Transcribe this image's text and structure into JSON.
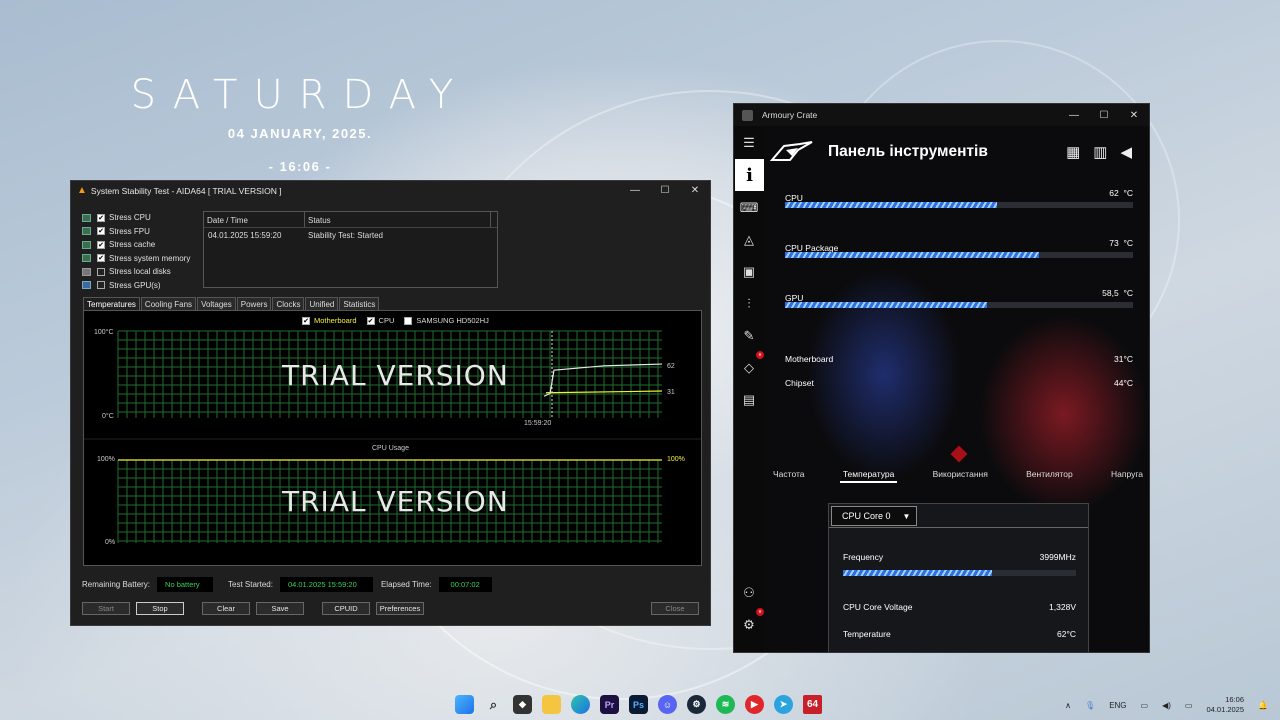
{
  "clock_widget": {
    "day": "SATURDAY",
    "date": "04 JANUARY, 2025.",
    "time": "- 16:06 -"
  },
  "aida": {
    "title": "System Stability Test - AIDA64  [ TRIAL VERSION ]",
    "window_controls": [
      "—",
      "☐",
      "✕"
    ],
    "stress_options": [
      {
        "label": "Stress CPU",
        "checked": true
      },
      {
        "label": "Stress FPU",
        "checked": true
      },
      {
        "label": "Stress cache",
        "checked": true
      },
      {
        "label": "Stress system memory",
        "checked": true
      },
      {
        "label": "Stress local disks",
        "checked": false
      },
      {
        "label": "Stress GPU(s)",
        "checked": false
      }
    ],
    "log": {
      "headers": [
        "Date / Time",
        "Status"
      ],
      "rows": [
        [
          "04.01.2025 15:59:20",
          "Stability Test: Started"
        ]
      ]
    },
    "tabs": [
      "Temperatures",
      "Cooling Fans",
      "Voltages",
      "Powers",
      "Clocks",
      "Unified",
      "Statistics"
    ],
    "temp_graph": {
      "legend": [
        "Motherboard",
        "CPU",
        "SAMSUNG HD502HJ"
      ],
      "y_top": "100°C",
      "y_bottom": "0°C",
      "x_label": "15:59:20",
      "watermark": "TRIAL VERSION",
      "value_cpu": "62",
      "value_mb": "31",
      "series_color_cpu": "#e8e8e8",
      "series_color_mb": "#f4f13a"
    },
    "usage_graph": {
      "title": "CPU Usage",
      "y_top": "100%",
      "y_bottom": "0%",
      "watermark": "TRIAL VERSION",
      "value": "100%",
      "series_color": "#f4f13a"
    },
    "status": {
      "battery_label": "Remaining Battery:",
      "battery_value": "No battery",
      "started_label": "Test Started:",
      "started_value": "04.01.2025 15:59:20",
      "elapsed_label": "Elapsed Time:",
      "elapsed_value": "00:07:02"
    },
    "buttons": {
      "start": "Start",
      "stop": "Stop",
      "clear": "Clear",
      "save": "Save",
      "cpuid": "CPUID",
      "preferences": "Preferences",
      "close": "Close"
    }
  },
  "armoury": {
    "title": "Armoury Crate",
    "window_controls": [
      "—",
      "☐",
      "✕"
    ],
    "header": "Панель інструментів",
    "bars": [
      {
        "label": "CPU",
        "value": "62",
        "unit": "°C",
        "fill_pct": 61
      },
      {
        "label": "CPU Package",
        "value": "73",
        "unit": "°C",
        "fill_pct": 73
      },
      {
        "label": "GPU",
        "value": "58,5",
        "unit": "°C",
        "fill_pct": 58
      }
    ],
    "readings": [
      {
        "label": "Motherboard",
        "value": "31°C"
      },
      {
        "label": "Chipset",
        "value": "44°C"
      }
    ],
    "tabs": [
      "Частота",
      "Температура",
      "Використання",
      "Вентилятор",
      "Напруга"
    ],
    "active_tab": "Температура",
    "panel": {
      "select": "CPU Core 0",
      "frequency_label": "Frequency",
      "frequency_value": "3999MHz",
      "frequency_fill_pct": 64,
      "voltage_label": "CPU Core Voltage",
      "voltage_value": "1,328V",
      "temp_label": "Temperature",
      "temp_value": "62°C"
    },
    "side_badges": [
      "н",
      "н"
    ]
  },
  "taskbar": {
    "apps": [
      "windows-start",
      "search",
      "armoury-crate",
      "file-explorer",
      "edge",
      "premiere-pro",
      "photoshop",
      "discord",
      "steam",
      "spotify",
      "youtube-music",
      "telegram",
      "aida64"
    ],
    "aida_label": "64",
    "pr_label": "Pr",
    "ps_label": "Ps",
    "tray": {
      "lang": "ENG",
      "time": "16:06",
      "date": "04.01.2025"
    }
  }
}
